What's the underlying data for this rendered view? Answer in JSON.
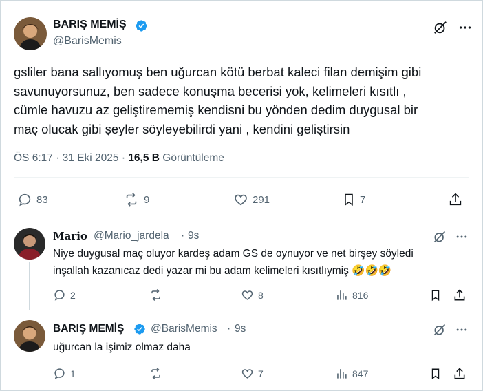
{
  "main_tweet": {
    "display_name": "BARIŞ MEMİŞ",
    "handle": "@BarisMemis",
    "text_lines": [
      "gsliler bana sallıyomuş ben uğurcan kötü berbat kaleci filan demişim gibi",
      "savunuyorsunuz, ben sadece konuşma becerisi yok, kelimeleri kısıtlı ,",
      "cümle havuzu az geliştirememiş kendisni bu yönden dedim duygusal bir",
      "maç olucak gibi şeyler söyleyebilirdi yani , kendini geliştirsin"
    ],
    "time": "ÖS 6:17",
    "date": "31 Eki 2025",
    "views_count": "16,5 B",
    "views_label": "Görüntüleme",
    "replies": "83",
    "reposts": "9",
    "likes": "291",
    "bookmarks": "7"
  },
  "reply_1": {
    "display_name": "Mario",
    "handle": "@Mario_jardela",
    "age": "9s",
    "text_line1": "Niye duygusal maç oluyor kardeş adam GS de oynuyor ve net birşey söyledi",
    "text_line2": "inşallah kazanıcaz dedi yazar mi bu adam  kelimeleri kısıtlıymiş",
    "emoji": "🤣🤣🤣",
    "replies": "2",
    "reposts": "",
    "likes": "8",
    "views": "816"
  },
  "reply_2": {
    "display_name": "BARIŞ MEMİŞ",
    "handle": "@BarisMemis",
    "age": "9s",
    "text": "uğurcan la işimiz olmaz daha",
    "replies": "1",
    "reposts": "",
    "likes": "7",
    "views": "847"
  },
  "colors": {
    "verified": "#1d9bf0",
    "secondary_text": "#536471",
    "primary_text": "#0f1419",
    "emoji": "#f7b731"
  },
  "icons": [
    "grok-icon",
    "more-icon",
    "reply-icon",
    "repost-icon",
    "like-icon",
    "bookmark-icon",
    "share-icon",
    "views-icon",
    "verified-icon"
  ]
}
